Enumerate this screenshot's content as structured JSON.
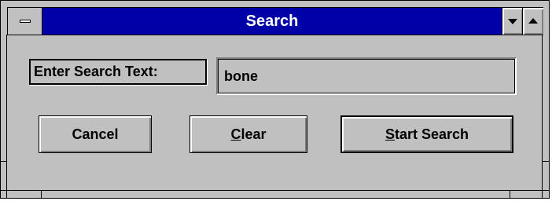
{
  "window": {
    "title": "Search"
  },
  "titlebar": {
    "system_menu_icon": "system-menu-icon",
    "minimize_icon": "minimize-arrow-icon",
    "maximize_icon": "maximize-arrow-icon"
  },
  "form": {
    "label": "Enter Search Text:",
    "search_value": "bone"
  },
  "buttons": {
    "cancel": "Cancel",
    "clear_accel": "C",
    "clear_rest": "lear",
    "start_accel": "S",
    "start_rest": "tart Search"
  },
  "colors": {
    "titlebar": "#0000a8",
    "face": "#c0c0c0"
  }
}
